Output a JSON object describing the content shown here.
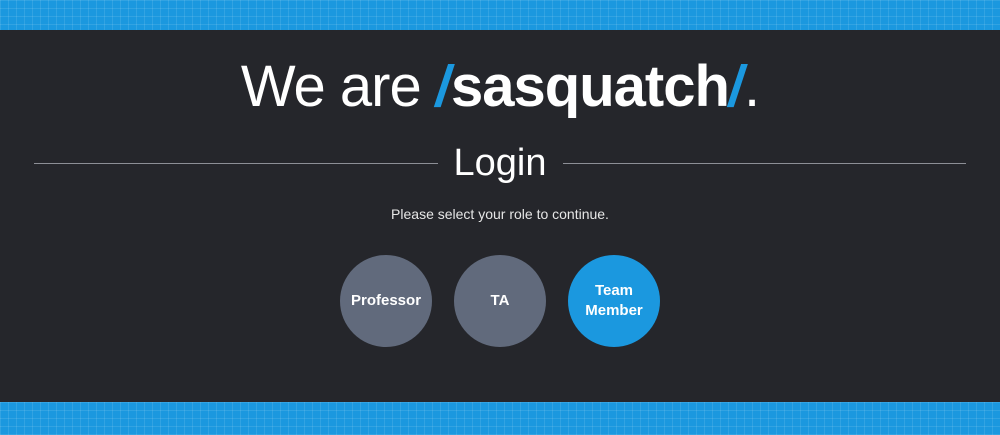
{
  "header": {
    "lead": "We are",
    "slash": "/",
    "brand": "sasquatch",
    "period": "."
  },
  "login": {
    "title": "Login",
    "subtitle": "Please select your role to continue."
  },
  "roles": [
    {
      "label": "Professor",
      "selected": false
    },
    {
      "label": "TA",
      "selected": false
    },
    {
      "label": "Team Member",
      "selected": true
    }
  ],
  "colors": {
    "accent": "#1b98df",
    "background": "#25262b",
    "role_default": "#616a7c"
  }
}
